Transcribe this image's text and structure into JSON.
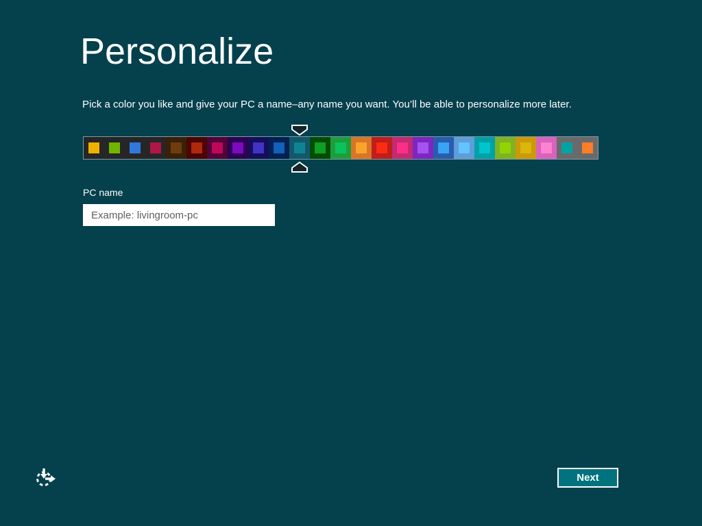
{
  "window": {
    "background_color": "#05404d"
  },
  "header": {
    "title": "Personalize"
  },
  "instruction": "Pick a color you like and give your PC a name–any name you want. You’ll be able to personalize more later.",
  "color_picker": {
    "selected_index": 10,
    "strip_border_color": "#7f9ba3",
    "marker_fill": "#13262a",
    "marker_stroke": "#ffffff",
    "tiles": [
      {
        "bg": "#262626",
        "accent": "#efb000"
      },
      {
        "bg": "#262626",
        "accent": "#70b500"
      },
      {
        "bg": "#262626",
        "accent": "#3079dc"
      },
      {
        "bg": "#262626",
        "accent": "#b01748"
      },
      {
        "bg": "#3a2008",
        "accent": "#6e3d0c"
      },
      {
        "bg": "#4d0404",
        "accent": "#ad2a0c"
      },
      {
        "bg": "#520339",
        "accent": "#c00758"
      },
      {
        "bg": "#2d0253",
        "accent": "#7c0ac0"
      },
      {
        "bg": "#150e5a",
        "accent": "#4134c4"
      },
      {
        "bg": "#022052",
        "accent": "#1261bd"
      },
      {
        "bg": "#11586b",
        "accent": "#0e8492"
      },
      {
        "bg": "#034d03",
        "accent": "#119e25"
      },
      {
        "bg": "#1d9e3d",
        "accent": "#0bc25c"
      },
      {
        "bg": "#da7527",
        "accent": "#fba42d"
      },
      {
        "bg": "#bf1e1a",
        "accent": "#fb2c13"
      },
      {
        "bg": "#c22a72",
        "accent": "#fb2e88"
      },
      {
        "bg": "#7c27be",
        "accent": "#a852f2"
      },
      {
        "bg": "#2a5cae",
        "accent": "#37a4f4"
      },
      {
        "bg": "#5e9dd8",
        "accent": "#63c3fb"
      },
      {
        "bg": "#00a0a8",
        "accent": "#00c4cc"
      },
      {
        "bg": "#7fb224",
        "accent": "#93d303"
      },
      {
        "bg": "#cc9908",
        "accent": "#d9b70c"
      },
      {
        "bg": "#d862bc",
        "accent": "#fb83d0"
      },
      {
        "bg": "#6a6a6a",
        "accent": "#00a3a3"
      },
      {
        "bg": "#6a6a6a",
        "accent": "#fb7e27"
      }
    ]
  },
  "pc_name": {
    "label": "PC name",
    "value": "",
    "placeholder": "Example: livingroom-pc"
  },
  "footer": {
    "next_label": "Next",
    "next_button_bg": "#00737f",
    "ease_of_access_icon": "ease-of-access"
  }
}
